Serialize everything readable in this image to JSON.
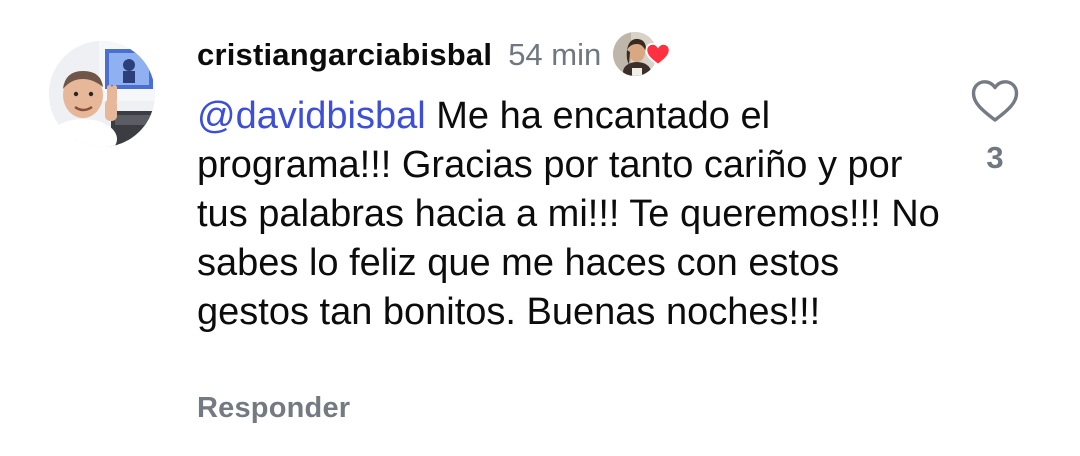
{
  "comment": {
    "username": "cristiangarciabisbal",
    "timestamp": "54 min",
    "mention": "@davidbisbal",
    "text": " Me ha encantado el programa!!! Gracias por tanto cariño y por tus palabras hacia a mi!!! Te queremos!!! No sabes lo feliz que me haces con estos gestos tan bonitos. Buenas noches!!!",
    "reply_label": "Responder",
    "like_count": "3",
    "creator_liked": true
  },
  "icons": {
    "like": "heart-outline-icon",
    "creator_like": "heart-filled-icon"
  },
  "colors": {
    "mention": "#3d4fd6",
    "secondary_text": "#737a82",
    "heart_red": "#ff3040"
  }
}
